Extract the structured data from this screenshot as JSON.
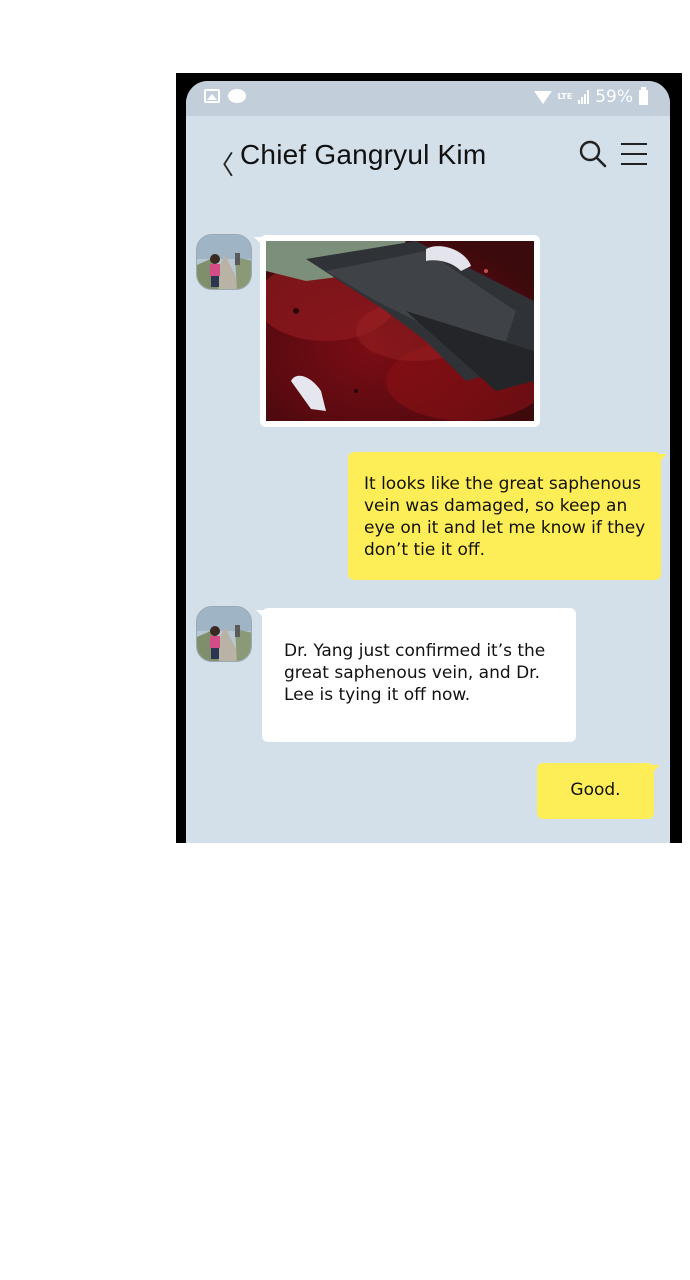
{
  "status_bar": {
    "icons": [
      "gallery-icon",
      "message-icon"
    ],
    "network": "LTE",
    "battery_percent": "59%"
  },
  "header": {
    "back_symbol": "〈",
    "title": "Chief Gangryul Kim",
    "search_icon": "search-icon",
    "menu_icon": "menu-icon"
  },
  "messages": [
    {
      "from": "other",
      "type": "image",
      "image": "injured-leg-photo"
    },
    {
      "from": "me",
      "type": "text",
      "text": "It looks like the great saphenous vein was damaged, so keep an eye on it and let me know if they don’t tie it off."
    },
    {
      "from": "other",
      "type": "text",
      "text": "Dr. Yang just confirmed it’s the great saphenous vein, and Dr. Lee is tying it off now."
    },
    {
      "from": "me",
      "type": "text",
      "text": "Good."
    }
  ],
  "colors": {
    "chat_background": "#d3e0ea",
    "status_bar": "#c2cfda",
    "my_bubble": "#fdee57",
    "other_bubble": "#ffffff"
  }
}
